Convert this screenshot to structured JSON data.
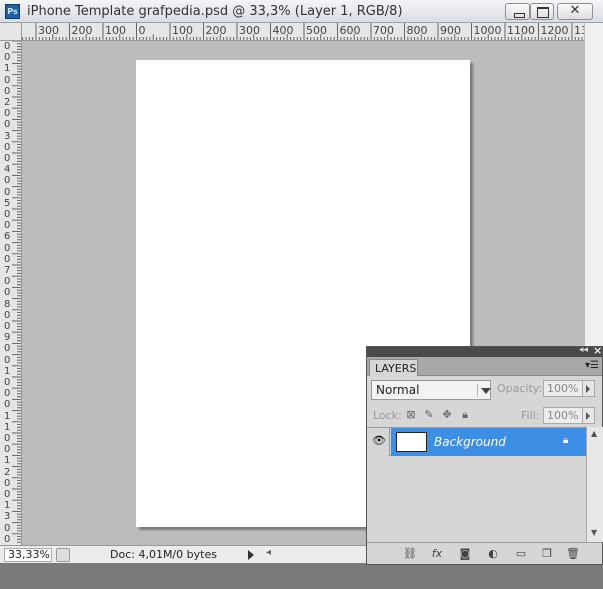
{
  "window": {
    "app_icon": "Ps",
    "title": "iPhone Template grafpedia.psd @ 33,3% (Layer 1, RGB/8)",
    "close_glyph": "✕"
  },
  "ruler_top": {
    "labels": [
      "300",
      "200",
      "100",
      "0",
      "100",
      "200",
      "300",
      "400",
      "500",
      "600",
      "700",
      "800",
      "900",
      "1000",
      "1100",
      "1200",
      "13"
    ]
  },
  "ruler_left": {
    "labels": [
      "0",
      "0",
      "1",
      "0",
      "0",
      "2",
      "0",
      "0",
      "3",
      "0",
      "0",
      "4",
      "0",
      "0",
      "5",
      "0",
      "0",
      "6",
      "0",
      "0",
      "7",
      "0",
      "0",
      "8",
      "0",
      "0",
      "9",
      "0",
      "0",
      "1",
      "0",
      "0",
      "0",
      "1",
      "1",
      "0",
      "0",
      "1",
      "2",
      "0",
      "0",
      "1",
      "3",
      "0",
      "0"
    ]
  },
  "status_bar": {
    "zoom": "33,33%",
    "doc_info": "Doc: 4,01M/0 bytes"
  },
  "layers_panel": {
    "tab_label": "LAYERS",
    "blend_mode": "Normal",
    "opacity_label": "Opacity:",
    "opacity_value": "100%",
    "lock_label": "Lock:",
    "fill_label": "Fill:",
    "fill_value": "100%",
    "layers": [
      {
        "name": "Background",
        "visible": true,
        "locked": true,
        "selected": true
      }
    ],
    "selection_color": "#3d8fe6"
  }
}
